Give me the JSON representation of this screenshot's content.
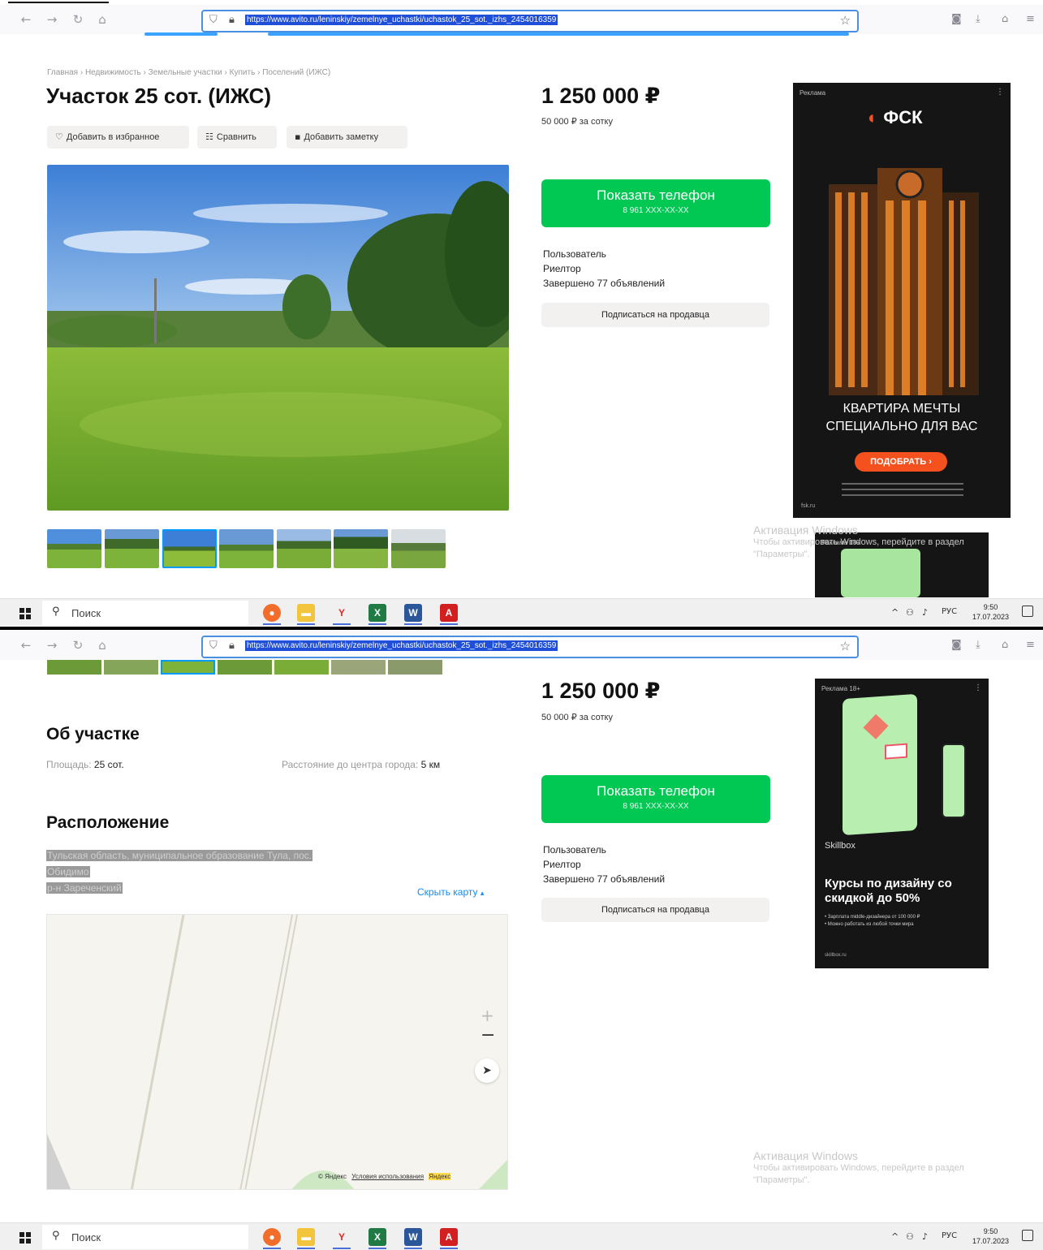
{
  "browser": {
    "url": "https://www.avito.ru/leninskiy/zemelnye_uchastki/uchastok_25_sot._izhs_2454016359"
  },
  "taskbar": {
    "search_label": "Поиск",
    "lang": "РУС",
    "time_top": "9:50",
    "date_top": "17.07.2023",
    "time_bottom": "9:50",
    "date_bottom": "17.07.2023"
  },
  "listing": {
    "breadcrumb": [
      "Главная",
      "Недвижимость",
      "Земельные участки",
      "Купить",
      "Поселений (ИЖС)"
    ],
    "title": "Участок 25 сот. (ИЖС)",
    "actions": {
      "favorite": "Добавить в избранное",
      "compare": "Сравнить",
      "note": "Добавить заметку"
    },
    "thumbnails_count": 7,
    "selected_thumbnail": 3
  },
  "sidebar": {
    "price": "1 250 000 ₽",
    "price_per_unit": "50 000 ₽ за сотку",
    "show_phone": "Показать телефон",
    "phone_masked": "8 961 XXX-XX-XX",
    "seller_type": "Пользователь",
    "seller_name": "Риелтор",
    "completed_ads": "Завершено 77 объявлений",
    "subscribe": "Подписаться на продавца"
  },
  "ad_fsk": {
    "label": "Реклама",
    "brand": "ФСК",
    "headline_1": "КВАРТИРА МЕЧТЫ",
    "headline_2": "СПЕЦИАЛЬНО ДЛЯ ВАС",
    "cta": "ПОДОБРАТЬ",
    "domain": "fsk.ru"
  },
  "ad_skillbox": {
    "label": "Реклама 18+",
    "brand": "Skillbox",
    "headline": "Курсы по дизайну со скидкой до 50%",
    "bullet_1": "Зарплата middle-дизайнера от 100 000 ₽",
    "bullet_2": "Можно работать из любой точки мира",
    "domain": "skillbox.ru"
  },
  "windows_watermark": {
    "title": "Активация Windows",
    "line1": "Чтобы активировать Windows, перейдите в раздел",
    "line2": "\"Параметры\"."
  },
  "about": {
    "heading": "Об участке",
    "area_label": "Площадь:",
    "area_value": "25 сот.",
    "distance_label": "Расстояние до центра города:",
    "distance_value": "5 км"
  },
  "location": {
    "heading": "Расположение",
    "address_1": "Тульская область, муниципальное образование Тула, пос.",
    "address_2": "Обидимо",
    "address_3": "р-н Зареченский",
    "hide_map": "Скрыть карту",
    "map_copyright": "© Яндекс",
    "map_terms": "Условия использования",
    "map_brand": "Яндекс"
  }
}
